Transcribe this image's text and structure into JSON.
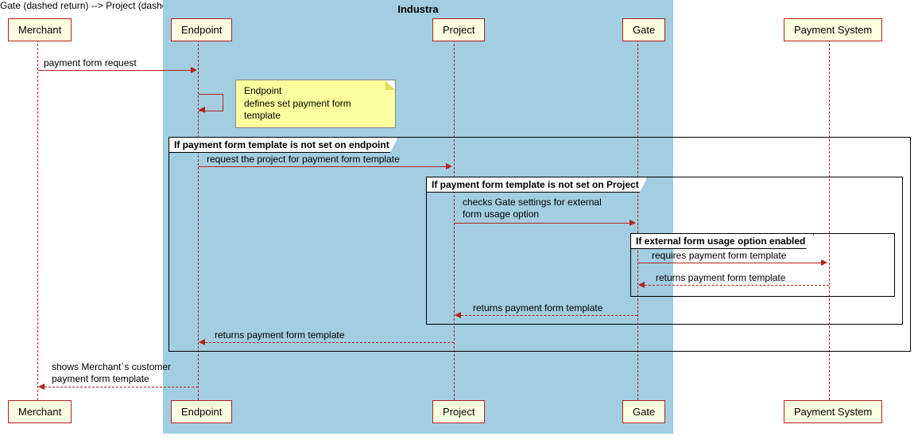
{
  "boxLabel": "Industra",
  "participants": {
    "merchant": "Merchant",
    "endpoint": "Endpoint",
    "project": "Project",
    "gate": "Gate",
    "paymentSystem": "Payment System"
  },
  "messages": {
    "m1": "payment form request",
    "note1_l1": "Endpoint",
    "note1_l2": "defines set payment form",
    "note1_l3": "template",
    "frag1": "If payment form template is not set on endpoint",
    "m2": "request the project for payment form template",
    "frag2": "If payment form template is not set on Project",
    "m3_l1": "checks Gate settings for external",
    "m3_l2": "form usage option",
    "frag3": "If external form usage option enabled",
    "m4": "requires payment form template",
    "m5": "returns payment form template",
    "m6": "returns payment form template",
    "m7": "returns payment form template",
    "m8_l1": "shows Merchant`s customer",
    "m8_l2": "payment form template"
  },
  "chart_data": {
    "type": "sequence-diagram",
    "box": {
      "name": "Industra",
      "participants": [
        "Endpoint",
        "Project",
        "Gate"
      ]
    },
    "participants": [
      "Merchant",
      "Endpoint",
      "Project",
      "Gate",
      "Payment System"
    ],
    "interactions": [
      {
        "from": "Merchant",
        "to": "Endpoint",
        "label": "payment form request",
        "style": "solid"
      },
      {
        "from": "Endpoint",
        "to": "Endpoint",
        "note": "Endpoint defines set payment form template"
      },
      {
        "fragment": "If payment form template is not set on endpoint",
        "children": [
          {
            "from": "Endpoint",
            "to": "Project",
            "label": "request the project for payment form template",
            "style": "solid"
          },
          {
            "fragment": "If payment form template is not set on Project",
            "children": [
              {
                "from": "Project",
                "to": "Gate",
                "label": "checks Gate settings for external form usage option",
                "style": "solid"
              },
              {
                "fragment": "If external form usage option enabled",
                "children": [
                  {
                    "from": "Gate",
                    "to": "Payment System",
                    "label": "requires payment form template",
                    "style": "solid"
                  },
                  {
                    "from": "Payment System",
                    "to": "Gate",
                    "label": "returns payment form template",
                    "style": "dashed"
                  }
                ]
              },
              {
                "from": "Gate",
                "to": "Project",
                "label": "returns payment form template",
                "style": "dashed"
              }
            ]
          },
          {
            "from": "Project",
            "to": "Endpoint",
            "label": "returns payment form template",
            "style": "dashed"
          }
        ]
      },
      {
        "from": "Endpoint",
        "to": "Merchant",
        "label": "shows Merchant`s customer payment form template",
        "style": "dashed"
      }
    ]
  }
}
